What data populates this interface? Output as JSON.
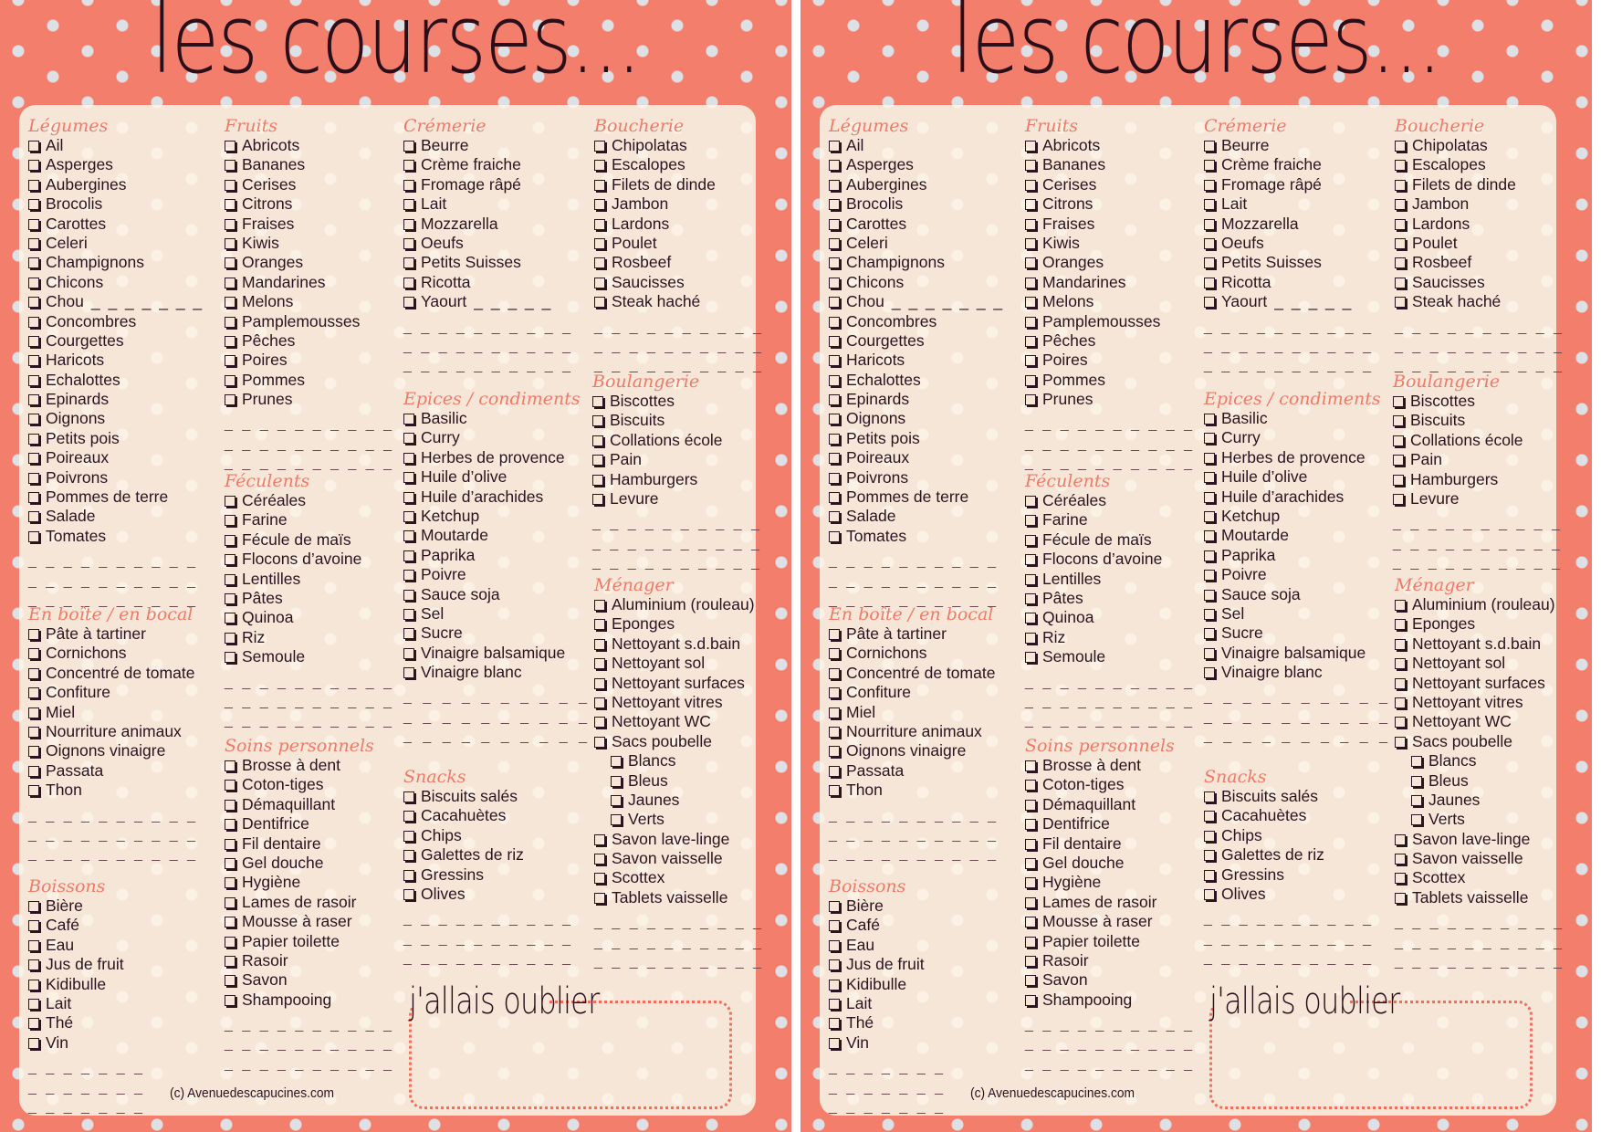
{
  "title": "les courses...",
  "forget_label": "j'allais oublier",
  "copyright": "(c) Avenuedescapucines.com",
  "colors": {
    "background": "#f47e6c",
    "card": "#f6e6d8",
    "heading": "#ef7a68",
    "text": "#2b1320"
  },
  "sections": {
    "legumes": {
      "title": "Légumes",
      "items": [
        "Ail",
        "Asperges",
        "Aubergines",
        "Brocolis",
        "Carottes",
        "Celeri",
        "Champignons",
        "Chicons",
        "Chou",
        "Concombres",
        "Courgettes",
        "Haricots",
        "Echalottes",
        "Epinards",
        "Oignons",
        "Petits pois",
        "Poireaux",
        "Poivrons",
        "Pommes de terre",
        "Salade",
        "Tomates"
      ]
    },
    "en_boite": {
      "title": "En boîte / en bocal",
      "items": [
        "Pâte à tartiner",
        "Cornichons",
        "Concentré de tomate",
        "Confiture",
        "Miel",
        "Nourriture animaux",
        "Oignons vinaigre",
        "Passata",
        "Thon"
      ]
    },
    "boissons": {
      "title": "Boissons",
      "items": [
        "Bière",
        "Café",
        "Eau",
        "Jus de fruit",
        "Kidibulle",
        "Lait",
        "Thé",
        "Vin"
      ]
    },
    "fruits": {
      "title": "Fruits",
      "items": [
        "Abricots",
        "Bananes",
        "Cerises",
        "Citrons",
        "Fraises",
        "Kiwis",
        "Oranges",
        "Mandarines",
        "Melons",
        "Pamplemousses",
        "Pêches",
        "Poires",
        "Pommes",
        "Prunes"
      ]
    },
    "feculents": {
      "title": "Féculents",
      "items": [
        "Céréales",
        "Farine",
        "Fécule de maïs",
        "Flocons d’avoine",
        "Lentilles",
        "Pâtes",
        "Quinoa",
        "Riz",
        "Semoule"
      ]
    },
    "soins": {
      "title": "Soins personnels",
      "items": [
        "Brosse à dent",
        "Coton-tiges",
        "Démaquillant",
        "Dentifrice",
        "Fil dentaire",
        "Gel douche",
        "Hygiène",
        "Lames de rasoir",
        "Mousse à raser",
        "Papier toilette",
        "Rasoir",
        "Savon",
        "Shampooing"
      ]
    },
    "cremerie": {
      "title": "Crémerie",
      "items": [
        "Beurre",
        "Crème fraiche",
        "Fromage râpé",
        "Lait",
        "Mozzarella",
        "Oeufs",
        "Petits Suisses",
        "Ricotta",
        "Yaourt"
      ]
    },
    "epices": {
      "title": "Epices / condiments",
      "items": [
        "Basilic",
        "Curry",
        "Herbes de provence",
        "Huile d’olive",
        "Huile d’arachides",
        "Ketchup",
        "Moutarde",
        "Paprika",
        "Poivre",
        "Sauce soja",
        "Sel",
        "Sucre",
        "Vinaigre balsamique",
        "Vinaigre blanc"
      ]
    },
    "snacks": {
      "title": "Snacks",
      "items": [
        "Biscuits salés",
        "Cacahuètes",
        "Chips",
        "Galettes de riz",
        "Gressins",
        "Olives"
      ]
    },
    "boucherie": {
      "title": "Boucherie",
      "items": [
        "Chipolatas",
        "Escalopes",
        "Filets de dinde",
        "Jambon",
        "Lardons",
        "Poulet",
        "Rosbeef",
        "Saucisses",
        "Steak haché"
      ]
    },
    "boulangerie": {
      "title": "Boulangerie",
      "items": [
        "Biscottes",
        "Biscuits",
        "Collations école",
        "Pain",
        "Hamburgers",
        "Levure"
      ]
    },
    "menager": {
      "title": "Ménager",
      "items": [
        "Aluminium (rouleau)",
        "Eponges",
        "Nettoyant s.d.bain",
        "Nettoyant sol",
        "Nettoyant surfaces",
        "Nettoyant vitres",
        "Nettoyant WC",
        "Sacs poubelle",
        "Blancs",
        "Bleus",
        "Jaunes",
        "Verts",
        "Savon lave-linge",
        "Savon vaisselle",
        "Scottex",
        "Tablets vaisselle"
      ]
    }
  },
  "blank_line": "_ _ _ _ _ _ _ _ _ _",
  "short_blank": "_ _ _ _ _ _ _",
  "short_blank_5": "_ _ _ _ _"
}
